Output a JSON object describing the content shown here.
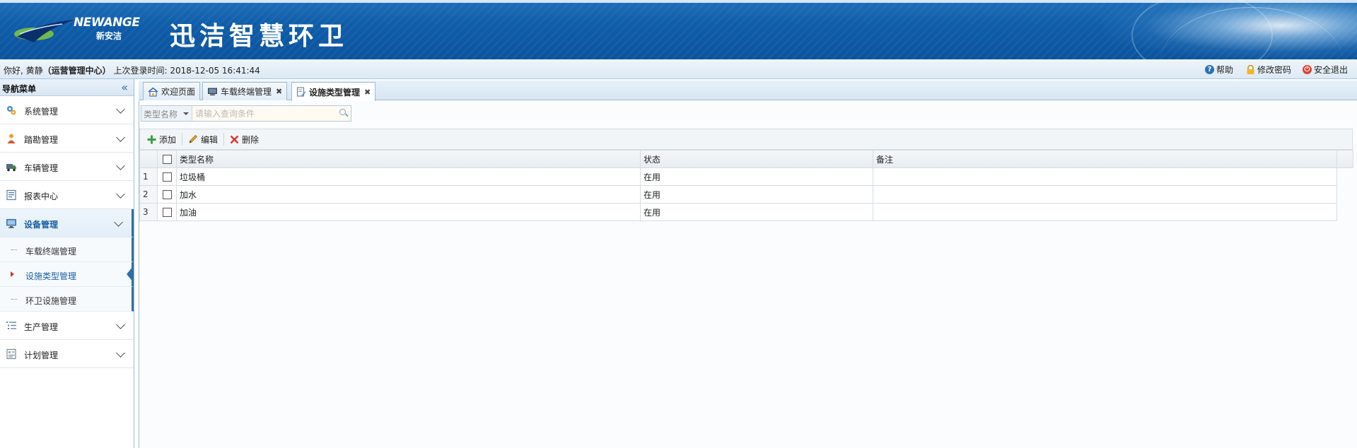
{
  "header": {
    "logo_en": "NEWANGE",
    "logo_cn": "新安洁",
    "app_title": "迅洁智慧环卫"
  },
  "infobar": {
    "greeting_prefix": "你好, 黄静",
    "org": "（运营管理中心）",
    "last_login_label": "上次登录时间: ",
    "last_login_time": "2018-12-05 16:41:44",
    "help": "帮助",
    "change_password": "修改密码",
    "logout": "安全退出"
  },
  "sidebar": {
    "title": "导航菜单",
    "groups": [
      {
        "label": "系统管理",
        "icon": "gears-icon"
      },
      {
        "label": "踏勘管理",
        "icon": "person-icon"
      },
      {
        "label": "车辆管理",
        "icon": "truck-icon"
      },
      {
        "label": "报表中心",
        "icon": "report-icon"
      },
      {
        "label": "设备管理",
        "icon": "monitor-icon",
        "active": true,
        "items": [
          {
            "label": "车载终端管理"
          },
          {
            "label": "设施类型管理",
            "active": true
          },
          {
            "label": "环卫设施管理"
          }
        ]
      },
      {
        "label": "生产管理",
        "icon": "list-icon"
      },
      {
        "label": "计划管理",
        "icon": "plan-icon"
      }
    ]
  },
  "tabs": [
    {
      "label": "欢迎页面",
      "closable": false
    },
    {
      "label": "车载终端管理",
      "closable": true
    },
    {
      "label": "设施类型管理",
      "closable": true,
      "active": true
    }
  ],
  "search": {
    "field": "类型名称",
    "placeholder": "请输入查询条件"
  },
  "toolbar": {
    "add": "添加",
    "edit": "编辑",
    "delete": "删除"
  },
  "grid": {
    "columns": [
      "类型名称",
      "状态",
      "备注"
    ],
    "rows": [
      {
        "num": "1",
        "name": "垃圾桶",
        "status": "在用",
        "remark": ""
      },
      {
        "num": "2",
        "name": "加水",
        "status": "在用",
        "remark": ""
      },
      {
        "num": "3",
        "name": "加油",
        "status": "在用",
        "remark": ""
      }
    ]
  },
  "colors": {
    "banner": "#0f5ca8",
    "accent": "#2e6ea8",
    "active_text": "#1b5fa3"
  }
}
